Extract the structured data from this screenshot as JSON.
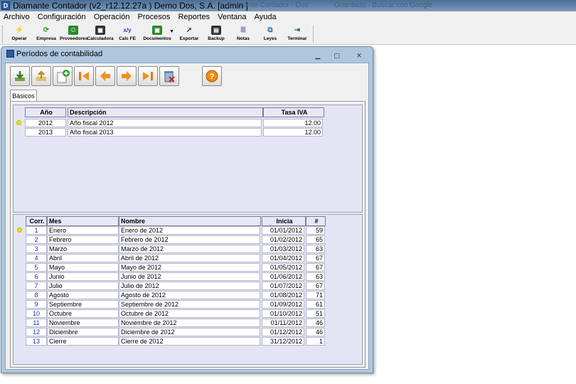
{
  "app": {
    "title": "Diamante Contador (v2_r12.12.27a ) Demo Dos, S.A.  [admin ]",
    "background_tabs": [
      "Diamante Contador - Dos",
      "Guardado - Buscar con Google"
    ]
  },
  "menu": [
    "Archivo",
    "Configuración",
    "Operación",
    "Procesos",
    "Reportes",
    "Ventana",
    "Ayuda"
  ],
  "toolbar": [
    {
      "label": "Operar",
      "icon": "lightning-icon",
      "color": "#e08a10"
    },
    {
      "label": "Empresa",
      "icon": "refresh-icon",
      "color": "#2a9a3a"
    },
    {
      "label": "Proveedores",
      "icon": "person-icon",
      "color": "#2a8a2a"
    },
    {
      "label": "Calculadora",
      "icon": "calculator-icon",
      "color": "#333333"
    },
    {
      "label": "Calc FE",
      "icon": "formula-icon",
      "color": "#2244aa"
    },
    {
      "label": "Documentos",
      "icon": "documents-icon",
      "color": "#2a8a2a"
    },
    {
      "label": "Exportar",
      "icon": "export-icon",
      "color": "#444444"
    },
    {
      "label": "Backup",
      "icon": "disk-icon",
      "color": "#333333"
    },
    {
      "label": "Notas",
      "icon": "notes-icon",
      "color": "#8888aa"
    },
    {
      "label": "Leyes",
      "icon": "laws-icon",
      "color": "#4477aa"
    },
    {
      "label": "Terminar",
      "icon": "exit-icon",
      "color": "#227722"
    }
  ],
  "window": {
    "title": "Períodos de contabilidad",
    "tab_label": "Básicos"
  },
  "form_toolbar": [
    {
      "name": "save-button",
      "icon": "save-icon"
    },
    {
      "name": "open-button",
      "icon": "open-icon"
    },
    {
      "name": "new-button",
      "icon": "new-icon"
    },
    {
      "name": "first-button",
      "icon": "first-icon"
    },
    {
      "name": "previous-button",
      "icon": "previous-icon"
    },
    {
      "name": "next-button",
      "icon": "next-icon"
    },
    {
      "name": "last-button",
      "icon": "last-icon"
    },
    {
      "name": "delete-button",
      "icon": "delete-icon"
    },
    {
      "name": "help-button",
      "icon": "help-icon"
    }
  ],
  "years_grid": {
    "headers": [
      "Año",
      "Descripción",
      "Tasa IVA"
    ],
    "rows": [
      {
        "year": "2012",
        "description": "Año fiscal 2012",
        "vat": "12.00"
      },
      {
        "year": "2013",
        "description": "Año fiscal 2013",
        "vat": "12.00"
      }
    ]
  },
  "periods_grid": {
    "headers": [
      "Corr.",
      "Mes",
      "Nombre",
      "Inicia",
      "#"
    ],
    "rows": [
      {
        "corr": "1",
        "month": "Enero",
        "name": "Enero de 2012",
        "start": "01/01/2012",
        "count": "59"
      },
      {
        "corr": "2",
        "month": "Febrero",
        "name": "Febrero de 2012",
        "start": "01/02/2012",
        "count": "65"
      },
      {
        "corr": "3",
        "month": "Marzo",
        "name": "Marzo de 2012",
        "start": "01/03/2012",
        "count": "63"
      },
      {
        "corr": "4",
        "month": "Abril",
        "name": "Abril de 2012",
        "start": "01/04/2012",
        "count": "67"
      },
      {
        "corr": "5",
        "month": "Mayo",
        "name": "Mayo de 2012",
        "start": "01/05/2012",
        "count": "67"
      },
      {
        "corr": "6",
        "month": "Junio",
        "name": "Junio de 2012",
        "start": "01/06/2012",
        "count": "63"
      },
      {
        "corr": "7",
        "month": "Julio",
        "name": "Julio de 2012",
        "start": "01/07/2012",
        "count": "67"
      },
      {
        "corr": "8",
        "month": "Agosto",
        "name": "Agosto de 2012",
        "start": "01/08/2012",
        "count": "71"
      },
      {
        "corr": "9",
        "month": "Septiembre",
        "name": "Septiembre de 2012",
        "start": "01/09/2012",
        "count": "61"
      },
      {
        "corr": "10",
        "month": "Octubre",
        "name": "Octubre de 2012",
        "start": "01/10/2012",
        "count": "51"
      },
      {
        "corr": "11",
        "month": "Noviembre",
        "name": "Noviembre de 2012",
        "start": "01/11/2012",
        "count": "46"
      },
      {
        "corr": "12",
        "month": "Diciembre",
        "name": "Diciembre de 2012",
        "start": "01/12/2012",
        "count": "46"
      },
      {
        "corr": "13",
        "month": "Cierre",
        "name": "Cierre de 2012",
        "start": "31/12/2012",
        "count": "1"
      }
    ]
  }
}
